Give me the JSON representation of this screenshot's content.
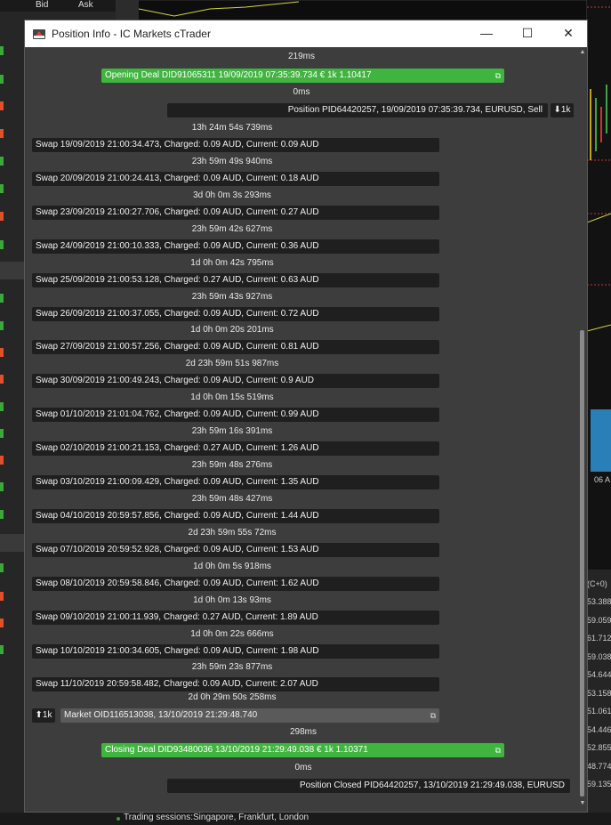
{
  "background": {
    "header_left": "Bid",
    "header_right": "Ask",
    "status_text": "Trading sessions:Singapore, Frankfurt, London",
    "right_label": "(C+0)",
    "right_values": [
      "53.388",
      "59.059",
      "61.712",
      "59.038",
      "54.644",
      "53.158",
      "51.061",
      "54.446",
      "52.855",
      "48.774",
      "59.135"
    ],
    "chart_tag": "06 A"
  },
  "dialog": {
    "title": "Position Info - IC Markets cTrader",
    "minimize": "—",
    "maximize": "☐",
    "close": "✕"
  },
  "timeline": {
    "gap_0": "219ms",
    "opening_deal": "Opening Deal DID91065311 19/09/2019 07:35:39.734 € 1k 1.10417",
    "gap_1": "0ms",
    "position": "Position PID64420257, 19/09/2019 07:35:39.734, EURUSD, Sell",
    "position_badge": "⬇1k",
    "swaps": [
      {
        "gap": "13h 24m 54s 739ms",
        "text": "Swap 19/09/2019 21:00:34.473, Charged: 0.09 AUD, Current: 0.09 AUD"
      },
      {
        "gap": "23h 59m 49s 940ms",
        "text": "Swap 20/09/2019 21:00:24.413, Charged: 0.09 AUD, Current: 0.18 AUD"
      },
      {
        "gap": "3d 0h 0m 3s 293ms",
        "text": "Swap 23/09/2019 21:00:27.706, Charged: 0.09 AUD, Current: 0.27 AUD"
      },
      {
        "gap": "23h 59m 42s 627ms",
        "text": "Swap 24/09/2019 21:00:10.333, Charged: 0.09 AUD, Current: 0.36 AUD"
      },
      {
        "gap": "1d 0h 0m 42s 795ms",
        "text": "Swap 25/09/2019 21:00:53.128, Charged: 0.27 AUD, Current: 0.63 AUD"
      },
      {
        "gap": "23h 59m 43s 927ms",
        "text": "Swap 26/09/2019 21:00:37.055, Charged: 0.09 AUD, Current: 0.72 AUD"
      },
      {
        "gap": "1d 0h 0m 20s 201ms",
        "text": "Swap 27/09/2019 21:00:57.256, Charged: 0.09 AUD, Current: 0.81 AUD"
      },
      {
        "gap": "2d 23h 59m 51s 987ms",
        "text": "Swap 30/09/2019 21:00:49.243, Charged: 0.09 AUD, Current: 0.9 AUD"
      },
      {
        "gap": "1d 0h 0m 15s 519ms",
        "text": "Swap 01/10/2019 21:01:04.762, Charged: 0.09 AUD, Current: 0.99 AUD"
      },
      {
        "gap": "23h 59m 16s 391ms",
        "text": "Swap 02/10/2019 21:00:21.153, Charged: 0.27 AUD, Current: 1.26 AUD"
      },
      {
        "gap": "23h 59m 48s 276ms",
        "text": "Swap 03/10/2019 21:00:09.429, Charged: 0.09 AUD, Current: 1.35 AUD"
      },
      {
        "gap": "23h 59m 48s 427ms",
        "text": "Swap 04/10/2019 20:59:57.856, Charged: 0.09 AUD, Current: 1.44 AUD"
      },
      {
        "gap": "2d 23h 59m 55s 72ms",
        "text": "Swap 07/10/2019 20:59:52.928, Charged: 0.09 AUD, Current: 1.53 AUD"
      },
      {
        "gap": "1d 0h 0m 5s 918ms",
        "text": "Swap 08/10/2019 20:59:58.846, Charged: 0.09 AUD, Current: 1.62 AUD"
      },
      {
        "gap": "1d 0h 0m 13s 93ms",
        "text": "Swap 09/10/2019 21:00:11.939, Charged: 0.27 AUD, Current: 1.89 AUD"
      },
      {
        "gap": "1d 0h 0m 22s 666ms",
        "text": "Swap 10/10/2019 21:00:34.605, Charged: 0.09 AUD, Current: 1.98 AUD"
      },
      {
        "gap": "23h 59m 23s 877ms",
        "text": "Swap 11/10/2019 20:59:58.482, Charged: 0.09 AUD, Current: 2.07 AUD"
      }
    ],
    "gap_market": "2d 0h 29m 50s 258ms",
    "market_badge": "⬆1k",
    "market": "Market OID116513038, 13/10/2019 21:29:48.740",
    "gap_closing": "298ms",
    "closing_deal": "Closing Deal DID93480036 13/10/2019 21:29:49.038 € 1k 1.10371",
    "gap_final": "0ms",
    "position_closed": "Position Closed PID64420257, 13/10/2019 21:29:49.038, EURUSD"
  }
}
